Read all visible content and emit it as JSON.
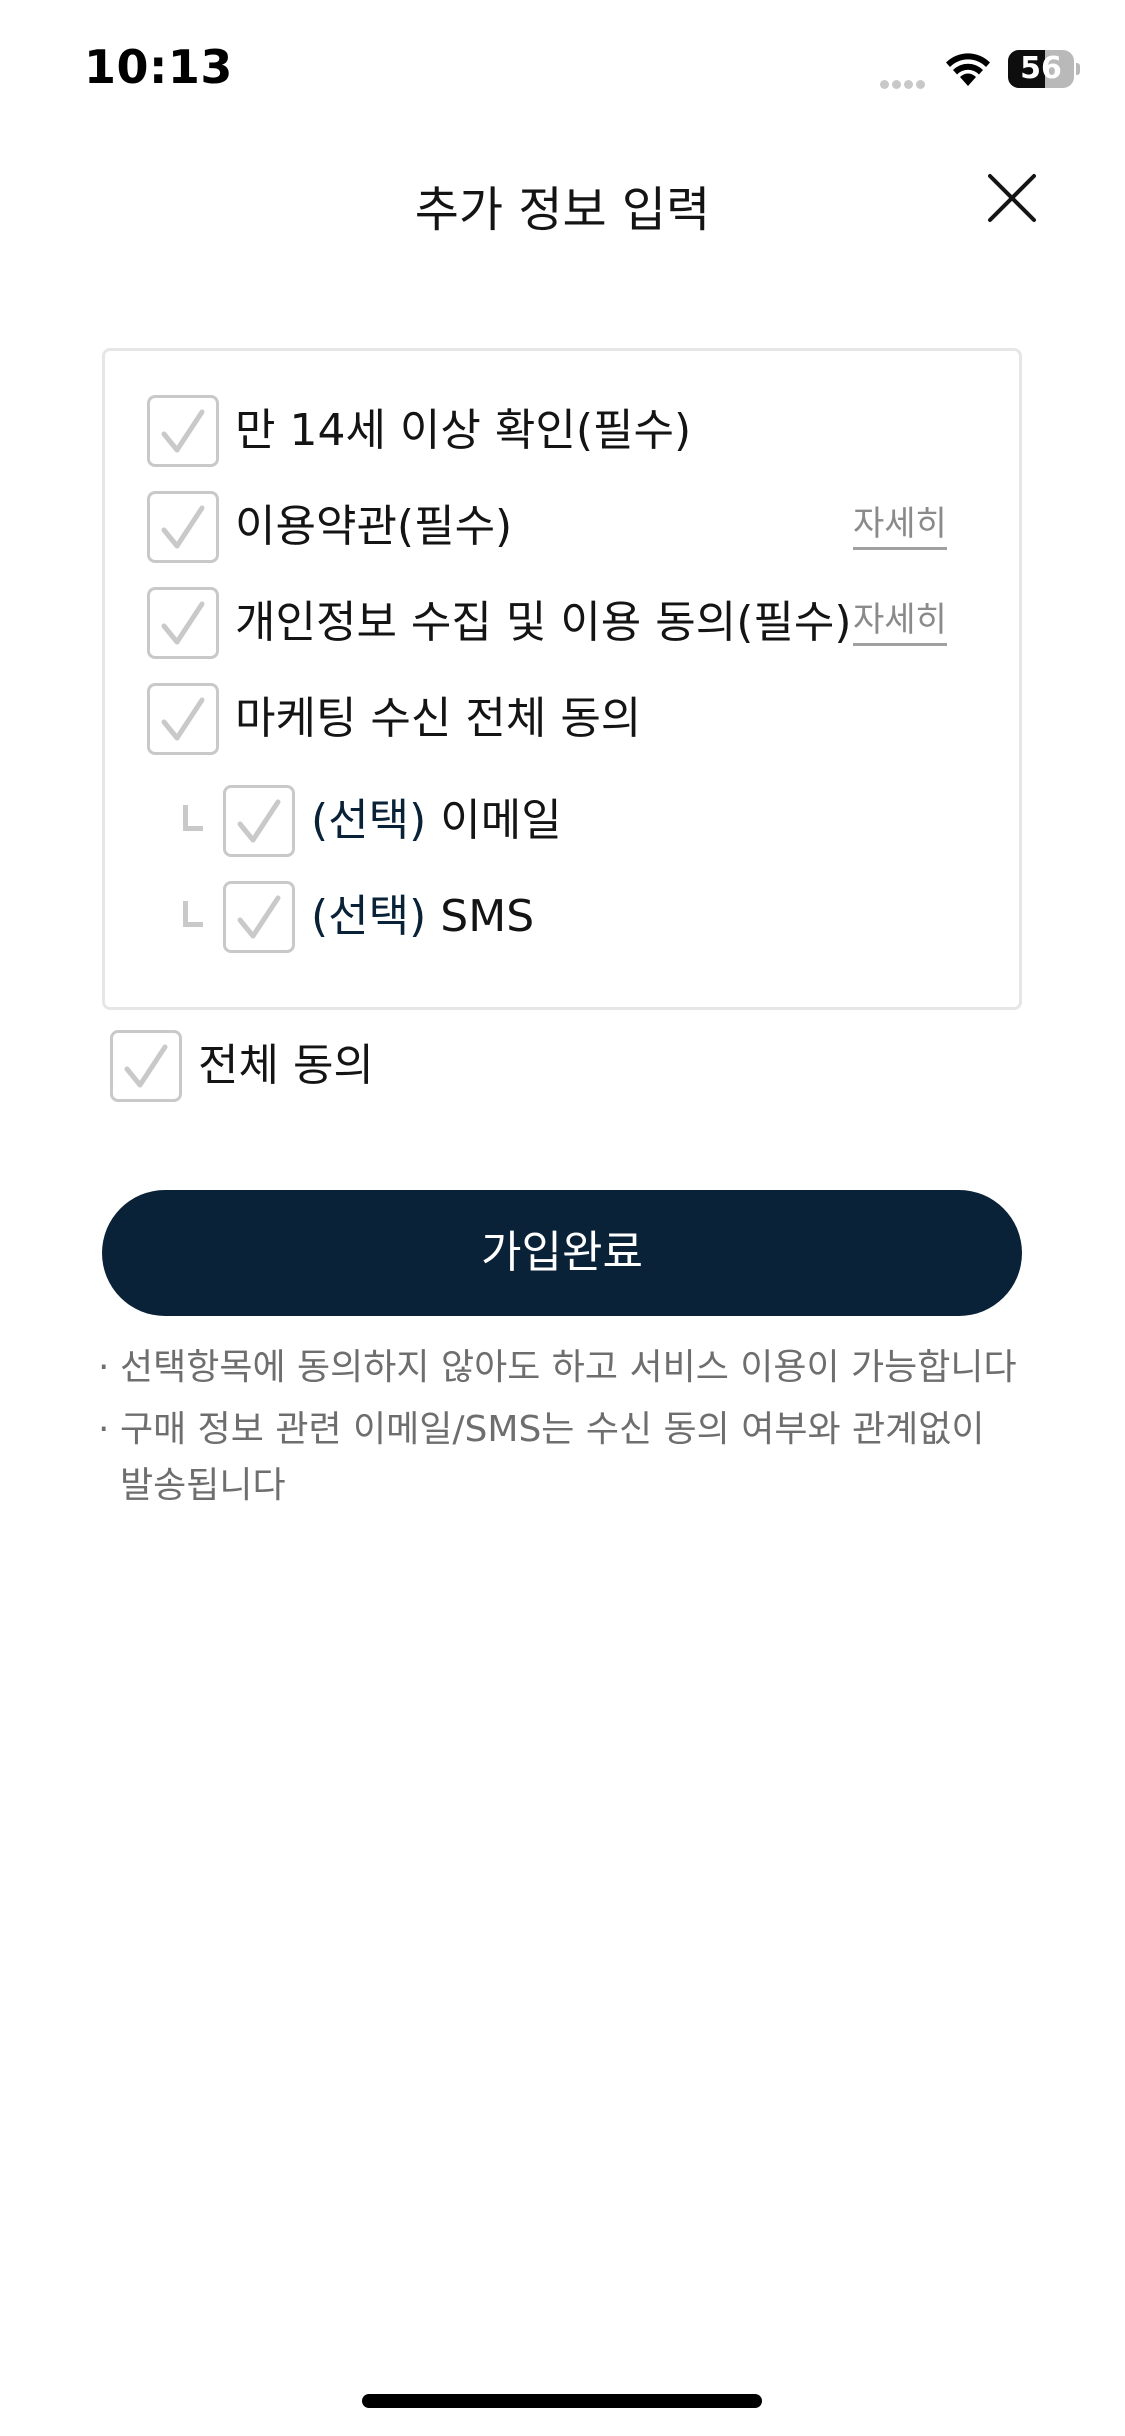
{
  "status_bar": {
    "time": "10:13",
    "battery_level": "56",
    "battery_fraction": 0.56
  },
  "header": {
    "title": "추가 정보 입력",
    "close_icon": "close-icon"
  },
  "agreements": {
    "items": [
      {
        "label": "만 14세 이상 확인(필수)",
        "checked": true
      },
      {
        "label": "이용약관(필수)",
        "checked": true,
        "detail_label": "자세히"
      },
      {
        "label": "개인정보 수집 및 이용 동의(필수)",
        "checked": true,
        "detail_label": "자세히"
      },
      {
        "label": "마케팅 수신 전체 동의",
        "checked": true
      }
    ],
    "sub_items": [
      {
        "prefix": "(선택)",
        "label": "이메일",
        "checked": true
      },
      {
        "prefix": "(선택)",
        "label": "SMS",
        "checked": true
      }
    ]
  },
  "all_agree": {
    "label": "전체 동의",
    "checked": true
  },
  "submit": {
    "label": "가입완료"
  },
  "notes": [
    {
      "bullet": "·",
      "text": "선택항목에 동의하지 않아도 하고 서비스 이용이 가능합니다"
    },
    {
      "bullet": "·",
      "text": "구매 정보 관련 이메일/SMS는 수신 동의 여부와 관계없이 발송됩니다"
    }
  ],
  "colors": {
    "primary": "#0a2238",
    "checkbox_border": "#c9c9c9",
    "note_text": "#6e6e6e"
  }
}
